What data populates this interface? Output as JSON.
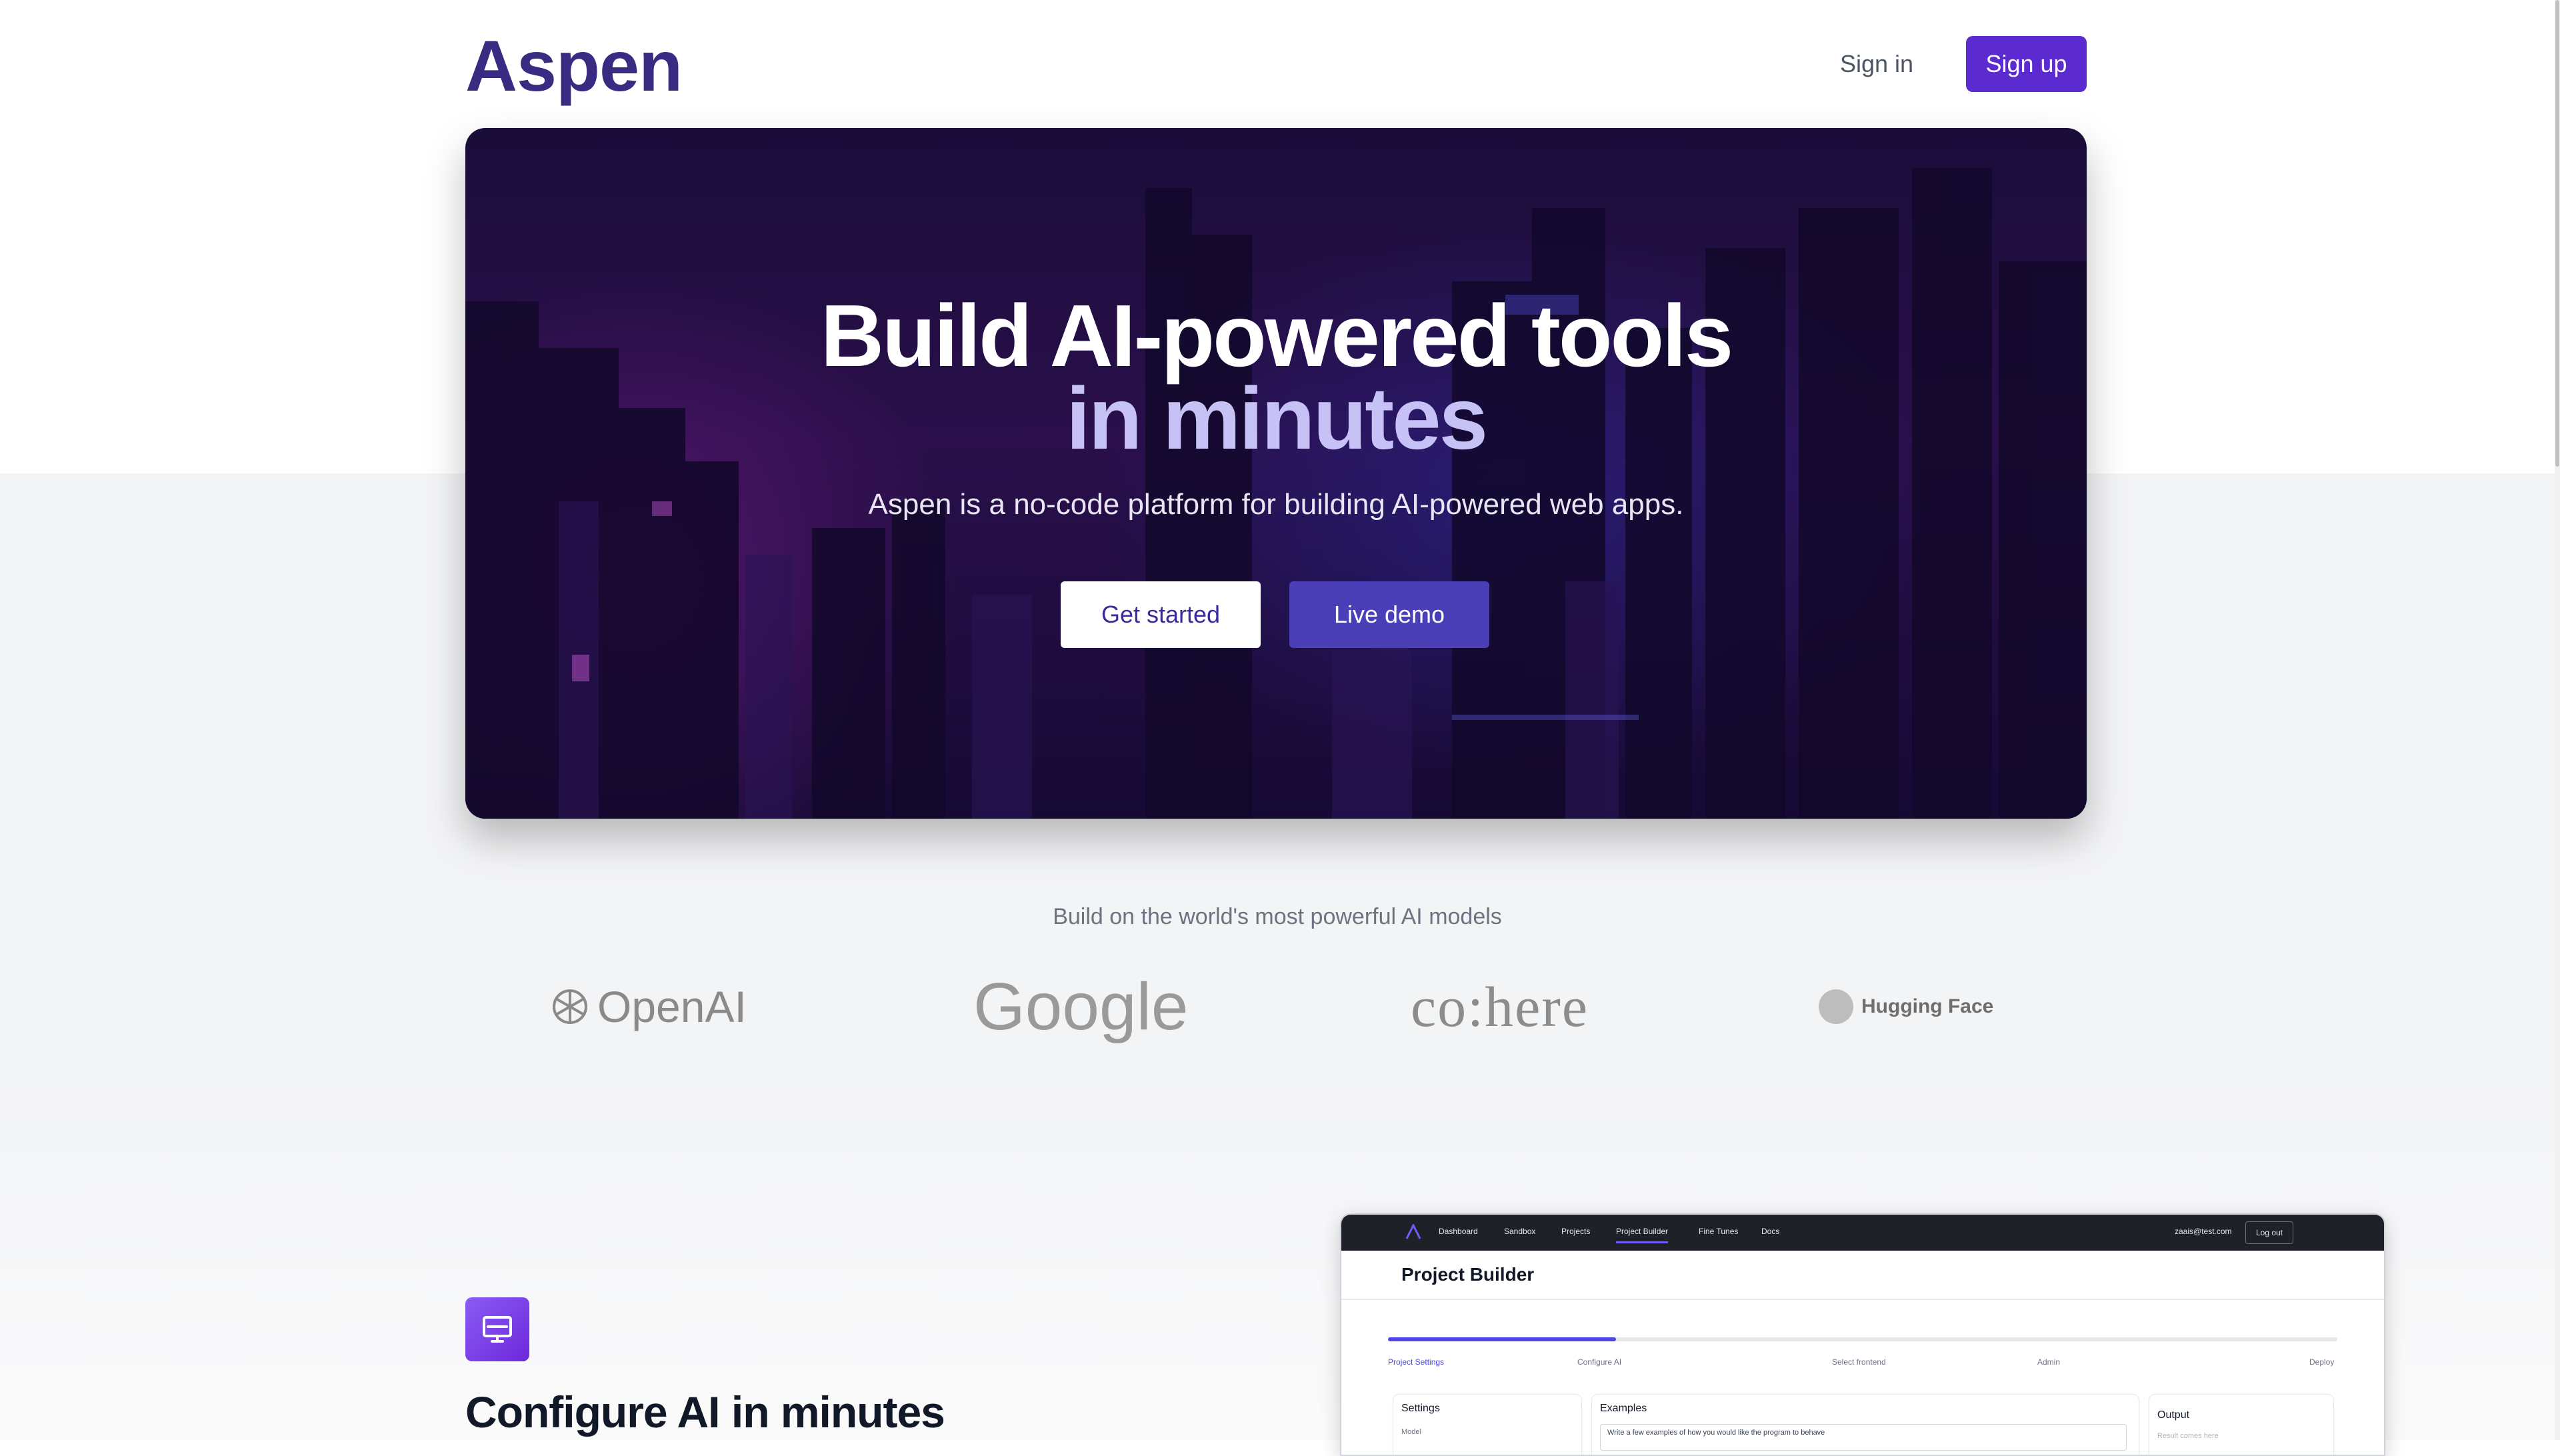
{
  "header": {
    "logo": "Aspen",
    "sign_in": "Sign in",
    "sign_up": "Sign up"
  },
  "hero": {
    "title_line1": "Build AI-powered tools",
    "title_line2": "in minutes",
    "subtitle": "Aspen is a no-code platform for building AI-powered web apps.",
    "primary_button": "Get started",
    "secondary_button": "Live demo"
  },
  "models": {
    "caption": "Build on the world's most powerful AI models",
    "logos": {
      "openai": "OpenAI",
      "google": "Google",
      "cohere": "co:here",
      "huggingface": "Hugging Face"
    }
  },
  "feature": {
    "icon": "monitor-icon",
    "title": "Configure AI in minutes"
  },
  "mockup": {
    "nav": [
      "Dashboard",
      "Sandbox",
      "Projects",
      "Project Builder",
      "Fine Tunes",
      "Docs"
    ],
    "active_nav": "Project Builder",
    "email": "zaais@test.com",
    "logout": "Log out",
    "page_title": "Project Builder",
    "progress": 0.24,
    "steps": [
      "Project Settings",
      "Configure AI",
      "Select frontend",
      "Admin",
      "Deploy"
    ],
    "active_step": "Project Settings",
    "cards": {
      "settings_title": "Settings",
      "settings_field": "Model",
      "examples_title": "Examples",
      "examples_text": "Write a few examples of how you would like the program to behave",
      "output_title": "Output",
      "output_placeholder": "Result comes here"
    }
  },
  "colors": {
    "brand": "#3b2a82",
    "signup_bg": "#5b2bd0",
    "demo_bg": "#4b3fb8",
    "hero_title_accent": "#c7c2f6"
  }
}
